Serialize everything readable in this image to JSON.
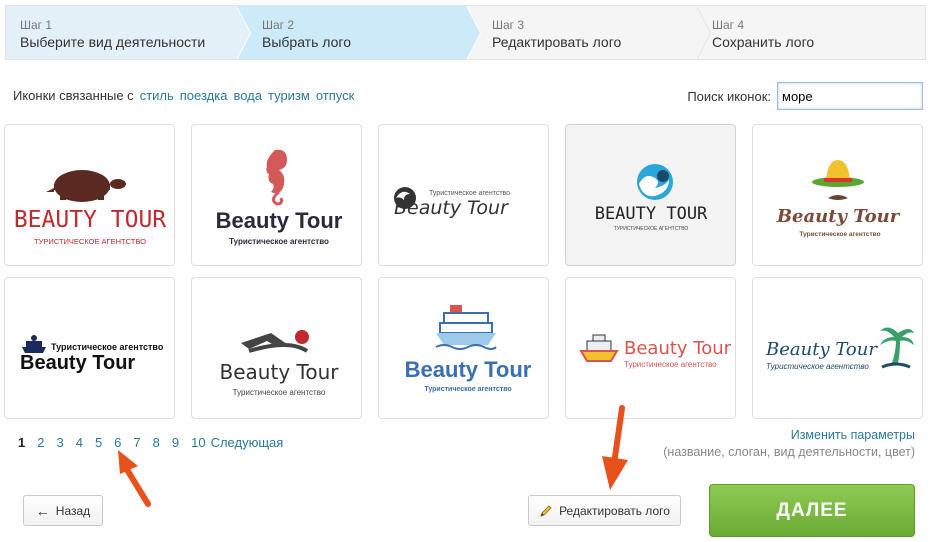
{
  "stepper": [
    {
      "num": "Шаг 1",
      "title": "Выберите вид деятельности"
    },
    {
      "num": "Шаг 2",
      "title": "Выбрать лого"
    },
    {
      "num": "Шаг 3",
      "title": "Редактировать лого"
    },
    {
      "num": "Шаг 4",
      "title": "Сохранить лого"
    }
  ],
  "tags": {
    "prefix": "Иконки связанные с",
    "items": [
      "стиль",
      "поездка",
      "вода",
      "туризм",
      "отпуск"
    ]
  },
  "search": {
    "label": "Поиск иконок:",
    "value": "море"
  },
  "logos": [
    {
      "name": "BEAUTY TOUR",
      "slogan": "ТУРИСТИЧЕСКОЕ АГЕНТСТВО",
      "icon": "turtle-icon",
      "color": "#c0292e"
    },
    {
      "name": "Beauty Tour",
      "slogan": "Туристическое агентство",
      "icon": "seahorse-icon",
      "color": "#2a2a3a"
    },
    {
      "name": "Beauty Tour",
      "slogan": "Туристическое агентство",
      "icon": "wave-icon",
      "color": "#333333"
    },
    {
      "name": "BEAUTY TOUR",
      "slogan": "ТУРИСТИЧЕСКОЕ АГЕНТСТВО",
      "icon": "wave-circle-icon",
      "color": "#222222"
    },
    {
      "name": "Beauty Tour",
      "slogan": "Туристическое агентство",
      "icon": "sombrero-icon",
      "color": "#7a4a3a"
    },
    {
      "name": "Beauty Tour",
      "slogan": "Туристическое агентство",
      "icon": "ship-icon",
      "color": "#111111"
    },
    {
      "name": "Beauty Tour",
      "slogan": "Туристическое агентство",
      "icon": "swimmer-icon",
      "color": "#333333"
    },
    {
      "name": "Beauty Tour",
      "slogan": "Туристическое агентство",
      "icon": "cruise-ship-icon",
      "color": "#3a6fb0"
    },
    {
      "name": "Beauty Tour",
      "slogan": "Туристическое агентство",
      "icon": "boat-icon",
      "color": "#d9534f"
    },
    {
      "name": "Beauty Tour",
      "slogan": "Туристическое агентство",
      "icon": "palm-icon",
      "color": "#1e4a6a"
    }
  ],
  "pagination": {
    "pages": [
      "1",
      "2",
      "3",
      "4",
      "5",
      "6",
      "7",
      "8",
      "9",
      "10"
    ],
    "next": "Следующая",
    "current": "1"
  },
  "params": {
    "link": "Изменить параметры",
    "hint": "(название, слоган, вид деятельности, цвет)"
  },
  "buttons": {
    "back": "Назад",
    "edit": "Редактировать лого",
    "next": "ДАЛЕЕ"
  },
  "colors": {
    "accent_link": "#2a7a9a",
    "next_button": "#7bbf45",
    "step_active": "#cdeaf9",
    "arrow_red": "#e8501c"
  }
}
